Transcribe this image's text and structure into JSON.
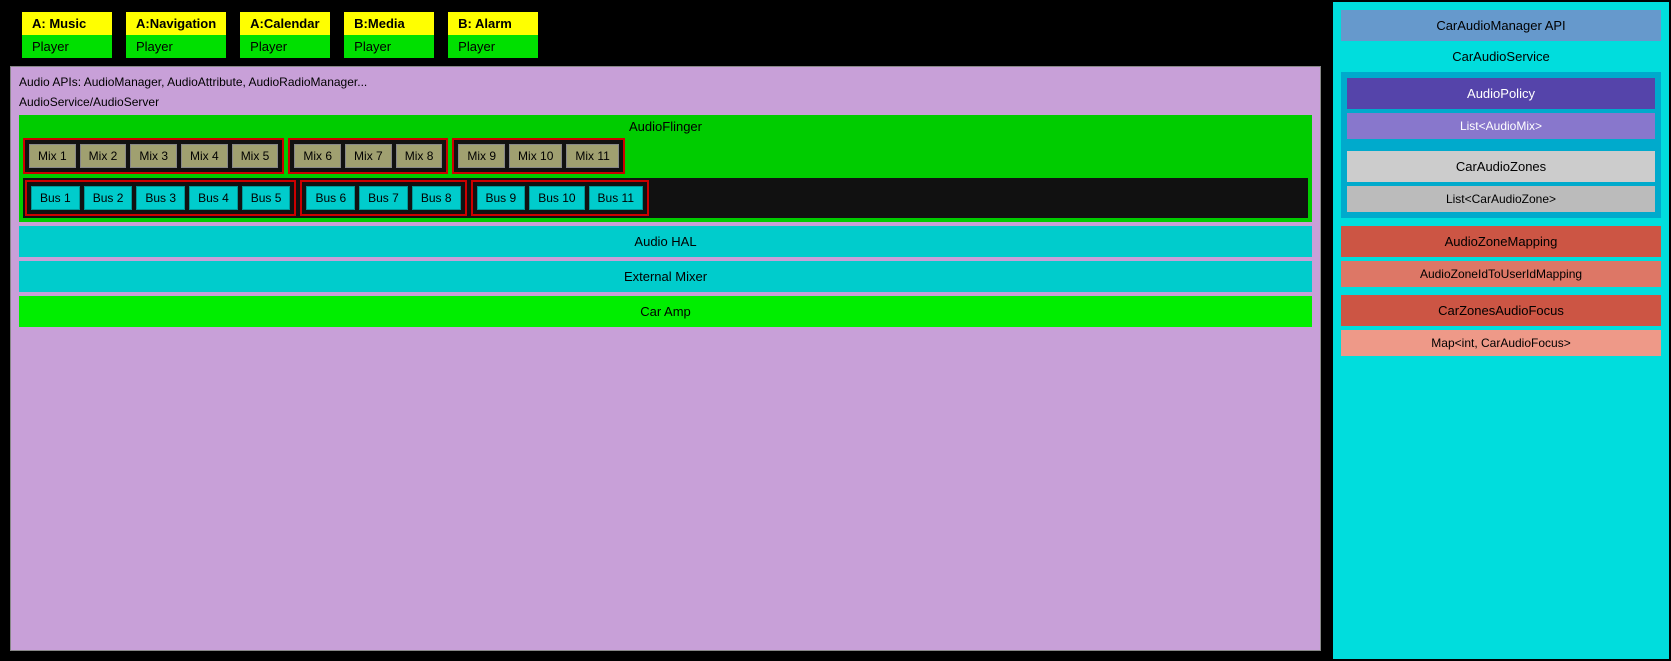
{
  "apps": [
    {
      "name": "A: Music",
      "player": "Player"
    },
    {
      "name": "A:Navigation",
      "player": "Player"
    },
    {
      "name": "A:Calendar",
      "player": "Player"
    },
    {
      "name": "B:Media",
      "player": "Player"
    },
    {
      "name": "B: Alarm",
      "player": "Player"
    }
  ],
  "arch": {
    "api_label": "Audio APIs: AudioManager, AudioAttribute, AudioRadioManager...",
    "service_label": "AudioService/AudioServer",
    "audioflinger_label": "AudioFlinger",
    "mix_groups": [
      {
        "mixes": [
          "Mix 1",
          "Mix 2",
          "Mix 3",
          "Mix 4",
          "Mix 5"
        ]
      },
      {
        "mixes": [
          "Mix 6",
          "Mix 7",
          "Mix 8"
        ]
      },
      {
        "mixes": [
          "Mix 9",
          "Mix 10",
          "Mix 11"
        ]
      }
    ],
    "bus_groups": [
      {
        "buses": [
          "Bus 1",
          "Bus 2",
          "Bus 3",
          "Bus 4",
          "Bus 5"
        ]
      },
      {
        "buses": [
          "Bus 6",
          "Bus 7",
          "Bus 8"
        ]
      },
      {
        "buses": [
          "Bus 9",
          "Bus 10",
          "Bus 11"
        ]
      }
    ],
    "audio_hal": "Audio HAL",
    "external_mixer": "External Mixer",
    "car_amp": "Car Amp"
  },
  "right_panel": {
    "car_audio_manager": "CarAudioManager API",
    "car_audio_service": "CarAudioService",
    "audio_policy": "AudioPolicy",
    "list_audiomix": "List<AudioMix>",
    "car_audio_zones": "CarAudioZones",
    "list_caraudiozone": "List<CarAudioZone>",
    "audio_zone_mapping": "AudioZoneMapping",
    "audiozoid_mapping": "AudioZoneIdToUserIdMapping",
    "car_zones_focus": "CarZonesAudioFocus",
    "map_caraudiofocus": "Map<int, CarAudioFocus>"
  }
}
